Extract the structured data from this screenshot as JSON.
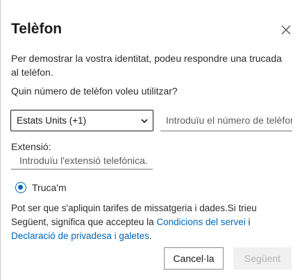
{
  "dialog": {
    "title": "Telèfon",
    "close_icon": "close-icon",
    "description": "Per demostrar la vostra identitat, podeu respondre una trucada al telèfon."
  },
  "form": {
    "question": "Quin número de telèfon voleu utilitzar?",
    "country": {
      "selected": "Estats Units (+1)",
      "icon": "chevron-down-icon"
    },
    "phone": {
      "value": "",
      "placeholder": "Introduïu el número de telèfon"
    },
    "extension": {
      "label": "Extensió:",
      "value": "",
      "placeholder": "Introduïu l'extensió telefònica."
    },
    "method": {
      "label": "Truca'm",
      "selected": true
    }
  },
  "notice": {
    "text_before": "Pot ser que s'apliquin tarifes de missatgeria i dades.Si trieu Següent, significa que accepteu la ",
    "terms_link": "Condicions del servei",
    "middle": " i ",
    "privacy_link": "Declaració de privadesa i galetes",
    "end": "."
  },
  "buttons": {
    "cancel": "Cancel·la",
    "next": "Següent",
    "next_disabled": true
  },
  "colors": {
    "accent": "#0067b8",
    "disabled_bg": "#f0f0f0",
    "disabled_text": "#b5b5b5"
  }
}
